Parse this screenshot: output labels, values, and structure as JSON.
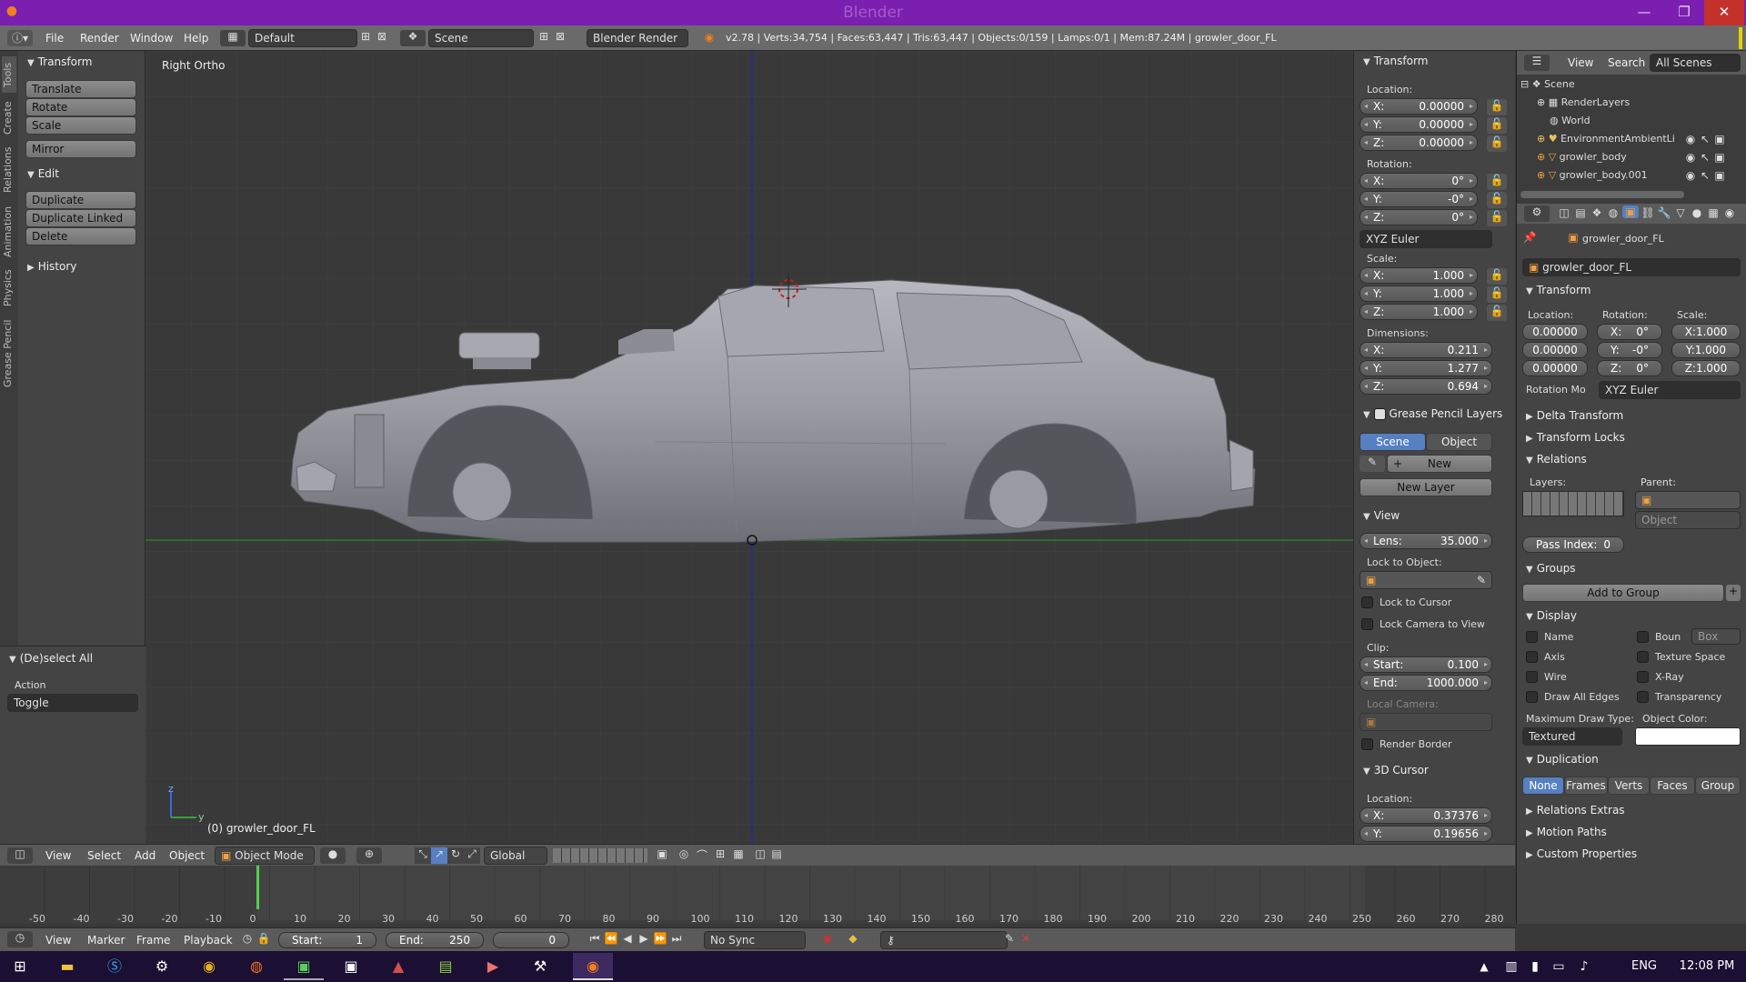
{
  "window": {
    "title": "Blender"
  },
  "menubar": {
    "menus": [
      "File",
      "Render",
      "Window",
      "Help"
    ],
    "layout": "Default",
    "scene": "Scene",
    "engine": "Blender Render",
    "stats": "v2.78 | Verts:34,754 | Faces:63,447 | Tris:63,447 | Objects:0/159 | Lamps:0/1 | Mem:87.24M | growler_door_FL"
  },
  "left_tabs": [
    "Tools",
    "Create",
    "Relations",
    "Animation",
    "Physics",
    "Grease Pencil"
  ],
  "tool_shelf": {
    "transform_header": "Transform",
    "transform_buttons": [
      "Translate",
      "Rotate",
      "Scale"
    ],
    "mirror": "Mirror",
    "edit_header": "Edit",
    "edit_buttons": [
      "Duplicate",
      "Duplicate Linked",
      "Delete"
    ],
    "history_header": "History",
    "operator_header": "(De)select All",
    "action_label": "Action",
    "action_value": "Toggle"
  },
  "viewport": {
    "view_name": "Right Ortho",
    "object_label": "(0) growler_door_FL",
    "axis_z": "z",
    "axis_y": "y"
  },
  "n_panel": {
    "transform_header": "Transform",
    "location_label": "Location:",
    "location": [
      {
        "axis": "X:",
        "value": "0.00000"
      },
      {
        "axis": "Y:",
        "value": "0.00000"
      },
      {
        "axis": "Z:",
        "value": "0.00000"
      }
    ],
    "rotation_label": "Rotation:",
    "rotation": [
      {
        "axis": "X:",
        "value": "0°"
      },
      {
        "axis": "Y:",
        "value": "-0°"
      },
      {
        "axis": "Z:",
        "value": "0°"
      }
    ],
    "rotation_mode": "XYZ Euler",
    "scale_label": "Scale:",
    "scale": [
      {
        "axis": "X:",
        "value": "1.000"
      },
      {
        "axis": "Y:",
        "value": "1.000"
      },
      {
        "axis": "Z:",
        "value": "1.000"
      }
    ],
    "dimensions_label": "Dimensions:",
    "dimensions": [
      {
        "axis": "X:",
        "value": "0.211"
      },
      {
        "axis": "Y:",
        "value": "1.277"
      },
      {
        "axis": "Z:",
        "value": "0.694"
      }
    ],
    "gp_header": "Grease Pencil Layers",
    "gp_scene": "Scene",
    "gp_object": "Object",
    "gp_new": "New",
    "gp_new_layer": "New Layer",
    "view_header": "View",
    "lens_label": "Lens:",
    "lens_value": "35.000",
    "lock_to_object": "Lock to Object:",
    "lock_to_cursor": "Lock to Cursor",
    "lock_camera": "Lock Camera to View",
    "clip_label": "Clip:",
    "clip_start_label": "Start:",
    "clip_start": "0.100",
    "clip_end_label": "End:",
    "clip_end": "1000.000",
    "local_camera": "Local Camera:",
    "render_border": "Render Border",
    "cursor_header": "3D Cursor",
    "cursor_location_label": "Location:",
    "cursor": [
      {
        "axis": "X:",
        "value": "0.37376"
      },
      {
        "axis": "Y:",
        "value": "0.19656"
      }
    ]
  },
  "outliner": {
    "view": "View",
    "search": "Search",
    "filter": "All Scenes",
    "items": [
      "Scene",
      "RenderLayers",
      "World",
      "EnvironmentAmbientLi",
      "growler_body",
      "growler_body.001"
    ]
  },
  "properties": {
    "object_path": "growler_door_FL",
    "object_name": "growler_door_FL",
    "transform_header": "Transform",
    "location_label": "Location:",
    "rotation_label": "Rotation:",
    "scale_label": "Scale:",
    "loc": [
      "0.00000",
      "0.00000",
      "0.00000"
    ],
    "rot": [
      {
        "axis": "X:",
        "value": "0°"
      },
      {
        "axis": "Y:",
        "value": "-0°"
      },
      {
        "axis": "Z:",
        "value": "0°"
      }
    ],
    "scl": [
      "X:1.000",
      "Y:1.000",
      "Z:1.000"
    ],
    "rotation_mode_label": "Rotation Mo",
    "rotation_mode": "XYZ Euler",
    "delta_transform": "Delta Transform",
    "transform_locks": "Transform Locks",
    "relations": "Relations",
    "layers_label": "Layers:",
    "parent_label": "Parent:",
    "parent_type": "Object",
    "pass_index_label": "Pass Index:",
    "pass_index": "0",
    "groups": "Groups",
    "add_to_group": "Add to Group",
    "display": "Display",
    "display_name": "Name",
    "display_bounds": "Boun",
    "display_bounds_type": "Box",
    "display_axis": "Axis",
    "display_texture_space": "Texture Space",
    "display_wire": "Wire",
    "display_xray": "X-Ray",
    "display_all_edges": "Draw All Edges",
    "display_transparency": "Transparency",
    "max_draw_type_label": "Maximum Draw Type:",
    "max_draw_type": "Textured",
    "object_color_label": "Object Color:",
    "duplication": "Duplication",
    "dup_options": [
      "None",
      "Frames",
      "Verts",
      "Faces",
      "Group"
    ],
    "relations_extras": "Relations Extras",
    "motion_paths": "Motion Paths",
    "custom_properties": "Custom Properties"
  },
  "view3d_header": {
    "menus": [
      "View",
      "Select",
      "Add",
      "Object"
    ],
    "mode": "Object Mode",
    "orientation": "Global"
  },
  "timeline": {
    "ticks": [
      "-50",
      "-40",
      "-30",
      "-20",
      "-10",
      "0",
      "10",
      "20",
      "30",
      "40",
      "50",
      "60",
      "70",
      "80",
      "90",
      "100",
      "110",
      "120",
      "130",
      "140",
      "150",
      "160",
      "170",
      "180",
      "190",
      "200",
      "210",
      "220",
      "230",
      "240",
      "250",
      "260",
      "270",
      "280"
    ],
    "current_frame_tick": 0
  },
  "timeline_header": {
    "menus": [
      "View",
      "Marker",
      "Frame",
      "Playback"
    ],
    "start_label": "Start:",
    "start": "1",
    "end_label": "End:",
    "end": "250",
    "current": "0",
    "sync": "No Sync"
  },
  "taskbar": {
    "lang": "ENG",
    "time": "12:08 PM"
  }
}
